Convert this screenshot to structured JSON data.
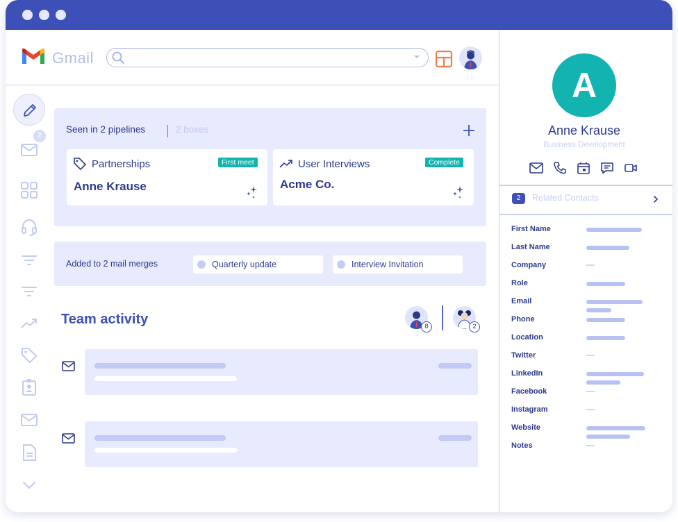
{
  "window": {
    "accent": "#3d50b8",
    "teal": "#13b3b1"
  },
  "gmail": {
    "wordmark": "Gmail"
  },
  "search": {
    "placeholder": ""
  },
  "left_rail": {
    "icons": [
      "pencil-icon",
      "mail-icon",
      "grid-icon",
      "headset-icon",
      "filter-icon",
      "filter-icon",
      "trending-icon",
      "tag-icon",
      "contact-card-icon",
      "mail-icon",
      "document-icon",
      "chevron-down-icon"
    ],
    "mail_badge": "2"
  },
  "pipelines": {
    "title": "Seen in 2 pipelines",
    "boxes_count": "2 boxes",
    "cards": [
      {
        "label": "Partnerships",
        "badge": "First meet",
        "value": "Anne Krause",
        "icon": "tag-icon"
      },
      {
        "label": "User Interviews",
        "badge": "Complete",
        "value": "Acme Co.",
        "icon": "trending-icon"
      }
    ]
  },
  "mail_merges": {
    "title": "Added to 2 mail merges",
    "items": [
      "Quarterly update",
      "Interview Invitation"
    ]
  },
  "team_activity": {
    "title": "Team activity",
    "avatars": [
      {
        "count": "8"
      },
      {
        "count": "2"
      }
    ]
  },
  "contact": {
    "initial": "A",
    "name": "Anne Krause",
    "role": "Business Development",
    "actions": [
      "mail-icon",
      "phone-icon",
      "calendar-icon",
      "chat-icon",
      "video-icon"
    ],
    "related_count": "2",
    "related_label": "Related Contacts",
    "fields": [
      "First Name",
      "Last Name",
      "Company",
      "Role",
      "Email",
      "Phone",
      "Location",
      "Twitter",
      "LinkedIn",
      "Facebook",
      "Instagram",
      "Website",
      "Notes"
    ]
  }
}
